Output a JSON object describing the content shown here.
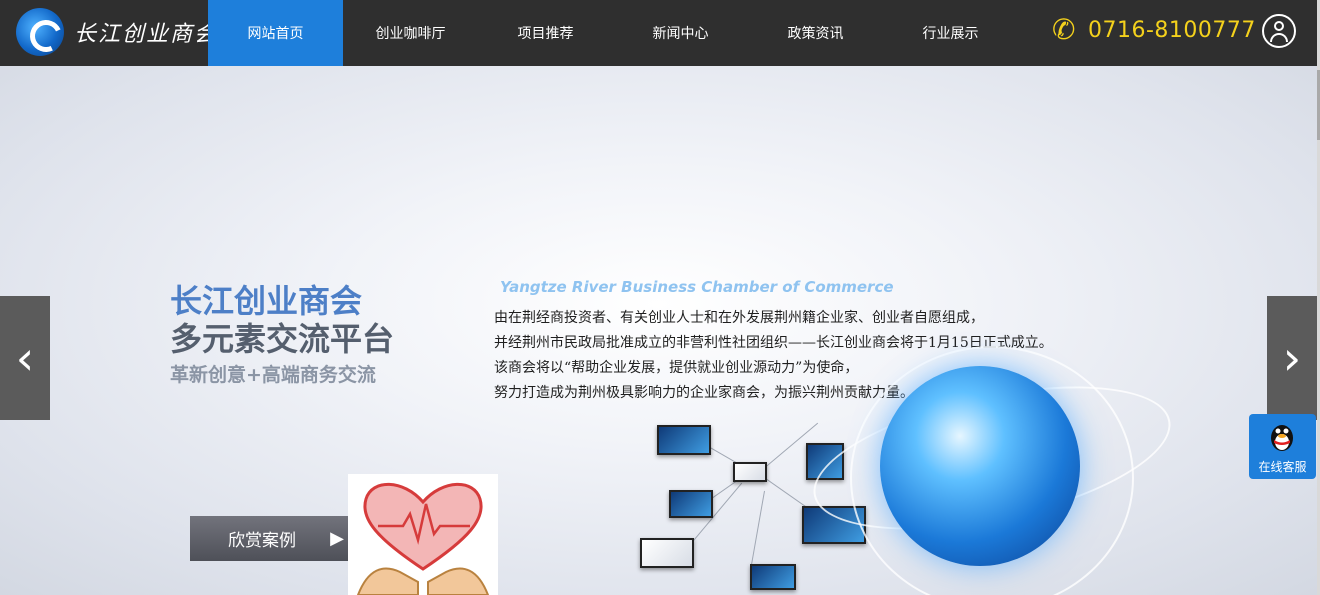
{
  "header": {
    "logo_text": "长江创业商会",
    "nav": [
      {
        "label": "网站首页",
        "active": true
      },
      {
        "label": "创业咖啡厅",
        "active": false
      },
      {
        "label": "项目推荐",
        "active": false
      },
      {
        "label": "新闻中心",
        "active": false
      },
      {
        "label": "政策资讯",
        "active": false
      },
      {
        "label": "行业展示",
        "active": false
      }
    ],
    "phone": "0716-8100777",
    "phone_icon": "phone-icon",
    "user_icon": "user-icon"
  },
  "banner": {
    "headline_1": "长江创业商会",
    "headline_2": "多元素交流平台",
    "subline": "革新创意+高端商务交流",
    "english_title": "Yangtze River Business Chamber of Commerce",
    "intro_lines": [
      "由在荆经商投资者、有关创业人士和在外发展荆州籍企业家、创业者自愿组成，",
      "并经荆州市民政局批准成立的非营利性社团组织——长江创业商会将于1月15日正式成立。",
      "该商会将以“帮助企业发展，提供就业创业源动力”为使命，",
      "努力打造成为荆州极具影响力的企业家商会，为振兴荆州贡献力量。"
    ],
    "case_button": "欣赏案例",
    "prev_arrow": "‹",
    "next_arrow": "›"
  },
  "service": {
    "label": "在线客服"
  },
  "colors": {
    "nav_active": "#1e7fdb",
    "header_bg": "#2f2f2f",
    "phone": "#f4d11c",
    "headline_blue": "#4d7fc7"
  }
}
